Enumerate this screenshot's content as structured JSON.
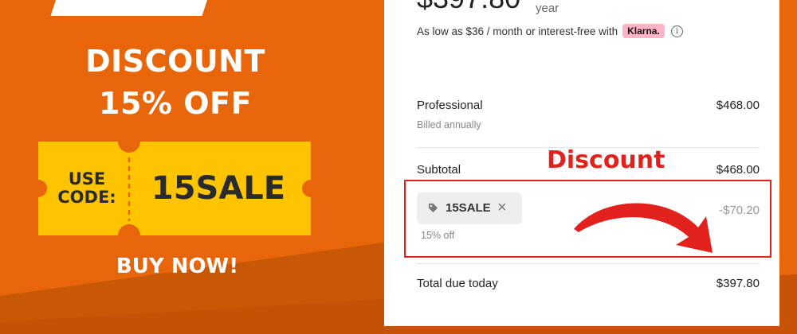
{
  "promo": {
    "title_line1": "DISCOUNT",
    "title_line2": "15% OFF",
    "ticket_use_line1": "USE",
    "ticket_use_line2": "CODE:",
    "ticket_code": "15SALE",
    "cta": "BUY NOW!"
  },
  "checkout": {
    "price": "$397.80",
    "period": "year",
    "installment_text": "As low as $36 / month or interest-free with",
    "klarna_label": "Klarna.",
    "info_icon": "info-icon",
    "plan_name": "Professional",
    "plan_billing": "Billed annually",
    "plan_amount": "$468.00",
    "subtotal_label": "Subtotal",
    "subtotal_amount": "$468.00",
    "promo_code": "15SALE",
    "promo_icon": "tag-icon",
    "promo_remove_icon": "close-icon",
    "promo_desc": "15% off",
    "discount_amount": "-$70.20",
    "total_label": "Total due today",
    "total_amount": "$397.80"
  },
  "annotation": {
    "label": "Discount",
    "color": "#e2211d"
  },
  "colors": {
    "background_orange": "#e8650a",
    "ticket_yellow": "#ffc400",
    "klarna_pink": "#ffb3c7"
  }
}
